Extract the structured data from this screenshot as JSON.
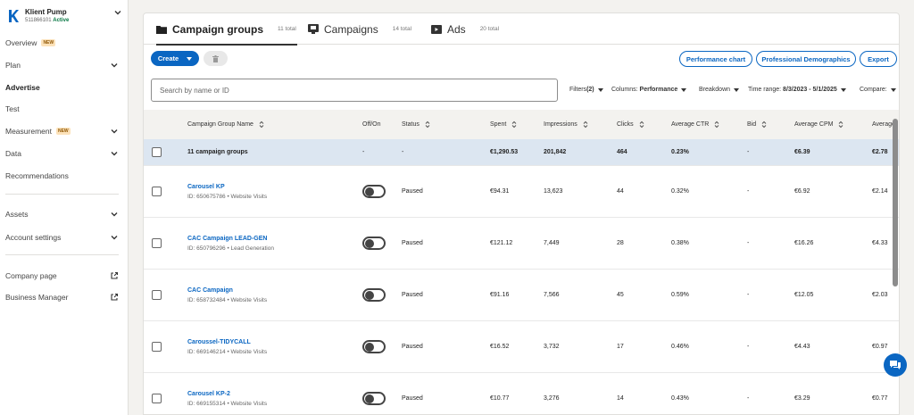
{
  "account": {
    "name": "Klient Pump",
    "id": "511866101",
    "status": "Active"
  },
  "sidebar": {
    "items": [
      {
        "label": "Overview",
        "badge": "NEW"
      },
      {
        "label": "Plan"
      },
      {
        "label": "Advertise"
      },
      {
        "label": "Test"
      },
      {
        "label": "Measurement",
        "badge": "NEW"
      },
      {
        "label": "Data"
      },
      {
        "label": "Recommendations"
      },
      {
        "label": "Assets"
      },
      {
        "label": "Account settings"
      },
      {
        "label": "Company page"
      },
      {
        "label": "Business Manager"
      }
    ]
  },
  "tabs": [
    {
      "label": "Campaign groups",
      "count": "11 total"
    },
    {
      "label": "Campaigns",
      "count": "14 total"
    },
    {
      "label": "Ads",
      "count": "20 total"
    }
  ],
  "toolbar": {
    "create_label": "Create",
    "performance_chart": "Performance chart",
    "professional_demographics": "Professional Demographics",
    "export": "Export"
  },
  "search": {
    "placeholder": "Search by name or ID"
  },
  "filters": {
    "filters_label": "Filters",
    "filters_count": "(2)",
    "columns_label": "Columns:",
    "columns_value": "Performance",
    "breakdown": "Breakdown",
    "time_range_label": "Time range:",
    "time_range_value": "8/3/2023 - 5/1/2025",
    "compare": "Compare:"
  },
  "table": {
    "headers": [
      "Campaign Group Name",
      "Off/On",
      "Status",
      "Spent",
      "Impressions",
      "Clicks",
      "Average CTR",
      "Bid",
      "Average CPM",
      "Average"
    ],
    "total": {
      "name": "11 campaign groups",
      "onoff": "-",
      "status": "-",
      "spent": "€1,290.53",
      "impressions": "201,842",
      "clicks": "464",
      "ctr": "0.23%",
      "bid": "-",
      "cpm": "€6.39",
      "avg": "€2.78"
    },
    "rows": [
      {
        "name": "Carousel KP",
        "sub": "ID: 650675786 • Website Visits",
        "status": "Paused",
        "spent": "€94.31",
        "impressions": "13,623",
        "clicks": "44",
        "ctr": "0.32%",
        "bid": "-",
        "cpm": "€6.92",
        "avg": "€2.14"
      },
      {
        "name": "CAC Campaign LEAD-GEN",
        "sub": "ID: 650796296 • Lead Generation",
        "status": "Paused",
        "spent": "€121.12",
        "impressions": "7,449",
        "clicks": "28",
        "ctr": "0.38%",
        "bid": "-",
        "cpm": "€16.26",
        "avg": "€4.33"
      },
      {
        "name": "CAC Campaign",
        "sub": "ID: 658732484 • Website Visits",
        "status": "Paused",
        "spent": "€91.16",
        "impressions": "7,566",
        "clicks": "45",
        "ctr": "0.59%",
        "bid": "-",
        "cpm": "€12.05",
        "avg": "€2.03"
      },
      {
        "name": "Caroussel-TIDYCALL",
        "sub": "ID: 669146214 • Website Visits",
        "status": "Paused",
        "spent": "€16.52",
        "impressions": "3,732",
        "clicks": "17",
        "ctr": "0.46%",
        "bid": "-",
        "cpm": "€4.43",
        "avg": "€0.97"
      },
      {
        "name": "Carousel KP-2",
        "sub": "ID: 669155314 • Website Visits",
        "status": "Paused",
        "spent": "€10.77",
        "impressions": "3,276",
        "clicks": "14",
        "ctr": "0.43%",
        "bid": "-",
        "cpm": "€3.29",
        "avg": "€0.77"
      }
    ]
  },
  "colors": {
    "accent": "#0a66c2",
    "active": "#057642",
    "total_row": "#dce6f1"
  }
}
